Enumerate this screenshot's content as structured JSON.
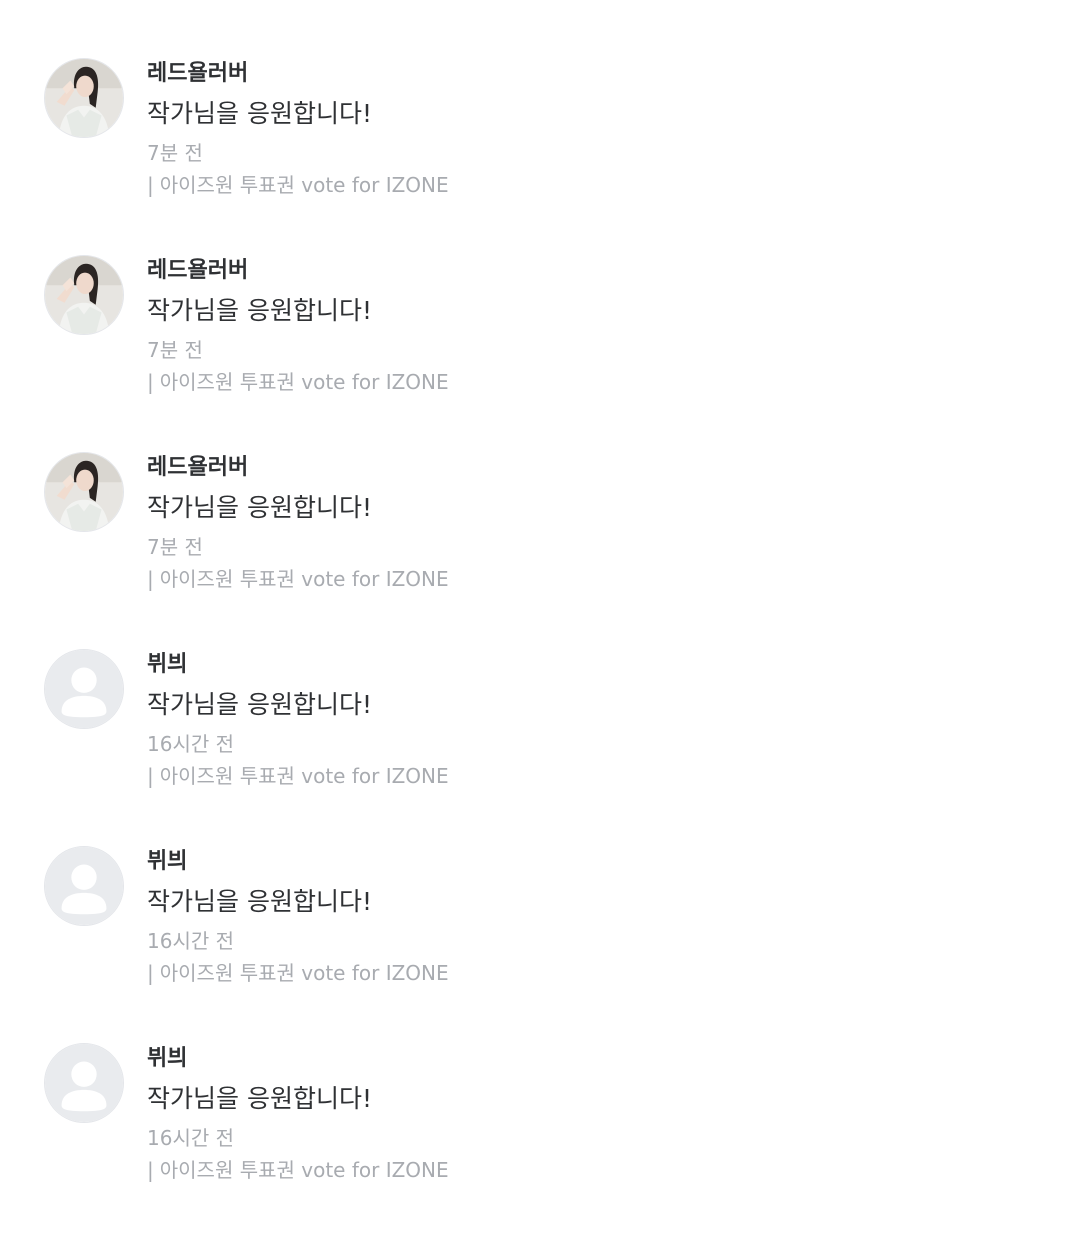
{
  "comments": [
    {
      "username": "레드욜러버",
      "message": "작가님을 응원합니다!",
      "time": "7분 전",
      "source_prefix": "|",
      "source": "아이즈원 투표권 vote for IZONE",
      "avatar": "photo-avatar-icon"
    },
    {
      "username": "레드욜러버",
      "message": "작가님을 응원합니다!",
      "time": "7분 전",
      "source_prefix": "|",
      "source": "아이즈원 투표권 vote for IZONE",
      "avatar": "photo-avatar-icon"
    },
    {
      "username": "레드욜러버",
      "message": "작가님을 응원합니다!",
      "time": "7분 전",
      "source_prefix": "|",
      "source": "아이즈원 투표권 vote for IZONE",
      "avatar": "photo-avatar-icon"
    },
    {
      "username": "뷔븨",
      "message": "작가님을 응원합니다!",
      "time": "16시간 전",
      "source_prefix": "|",
      "source": "아이즈원 투표권 vote for IZONE",
      "avatar": "default-user-icon"
    },
    {
      "username": "뷔븨",
      "message": "작가님을 응원합니다!",
      "time": "16시간 전",
      "source_prefix": "|",
      "source": "아이즈원 투표권 vote for IZONE",
      "avatar": "default-user-icon"
    },
    {
      "username": "뷔븨",
      "message": "작가님을 응원합니다!",
      "time": "16시간 전",
      "source_prefix": "|",
      "source": "아이즈원 투표권 vote for IZONE",
      "avatar": "default-user-icon"
    }
  ],
  "colors": {
    "primary_text": "#2f3134",
    "secondary_text": "#a8abb0",
    "default_avatar_bg": "#e9ebee"
  }
}
